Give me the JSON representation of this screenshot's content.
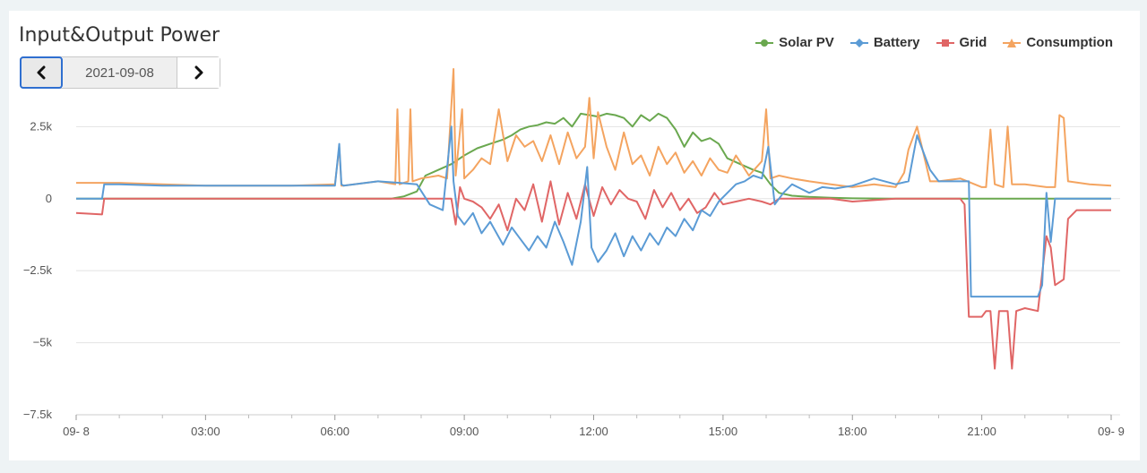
{
  "title": "Input&Output Power",
  "date_nav": {
    "date": "2021-09-08"
  },
  "colors": {
    "solar": "#6aa84f",
    "battery": "#5b9bd5",
    "grid": "#e06666",
    "consumption": "#f4a460"
  },
  "chart_data": {
    "type": "line",
    "title": "Input&Output Power",
    "xlabel": "",
    "ylabel": "",
    "ylim": [
      -7500,
      4500
    ],
    "xlim": [
      0,
      24
    ],
    "grid": "horizontal",
    "legend": "top-right",
    "yticks": [
      2500,
      0,
      -2500,
      -5000,
      -7500
    ],
    "ytick_labels": [
      "2.5k",
      "0",
      "−2.5k",
      "−5k",
      "−7.5k"
    ],
    "xticks": [
      0,
      3,
      6,
      9,
      12,
      15,
      18,
      21,
      24
    ],
    "xtick_labels": [
      "09- 8",
      "03:00",
      "06:00",
      "09:00",
      "12:00",
      "15:00",
      "18:00",
      "21:00",
      "09- 9"
    ],
    "series": [
      {
        "name": "Solar PV",
        "key": "solar",
        "marker": "circle",
        "x": [
          0,
          6,
          7.3,
          7.6,
          7.9,
          8.1,
          8.4,
          8.7,
          9.0,
          9.3,
          9.6,
          9.9,
          10.1,
          10.3,
          10.5,
          10.7,
          10.9,
          11.1,
          11.3,
          11.5,
          11.7,
          11.9,
          12.1,
          12.3,
          12.5,
          12.7,
          12.9,
          13.1,
          13.3,
          13.5,
          13.7,
          13.9,
          14.1,
          14.3,
          14.5,
          14.7,
          14.9,
          15.1,
          15.4,
          15.7,
          15.9,
          16.1,
          16.3,
          16.6,
          17.0,
          17.5,
          18.0,
          19.0,
          20.0,
          21.0,
          22.0,
          23.0,
          24.0
        ],
        "y": [
          0,
          0,
          0,
          80,
          250,
          800,
          1000,
          1200,
          1500,
          1750,
          1900,
          2050,
          2200,
          2400,
          2500,
          2550,
          2650,
          2600,
          2800,
          2500,
          2950,
          2900,
          2850,
          2950,
          2900,
          2800,
          2500,
          2900,
          2700,
          2950,
          2800,
          2400,
          1800,
          2300,
          2000,
          2100,
          1900,
          1400,
          1200,
          1000,
          900,
          500,
          200,
          100,
          60,
          30,
          10,
          0,
          0,
          0,
          0,
          0,
          0
        ]
      },
      {
        "name": "Battery",
        "key": "battery",
        "marker": "diamond",
        "x": [
          0,
          0.6,
          0.65,
          1,
          2,
          3,
          4,
          5,
          6,
          6.1,
          6.15,
          6.2,
          7,
          7.5,
          7.9,
          8.2,
          8.5,
          8.7,
          8.75,
          8.85,
          9.0,
          9.2,
          9.4,
          9.6,
          9.9,
          10.1,
          10.3,
          10.5,
          10.7,
          10.9,
          11.1,
          11.3,
          11.5,
          11.7,
          11.85,
          11.95,
          12.1,
          12.3,
          12.5,
          12.7,
          12.9,
          13.1,
          13.3,
          13.5,
          13.7,
          13.9,
          14.1,
          14.3,
          14.5,
          14.7,
          14.9,
          15.1,
          15.3,
          15.5,
          15.7,
          15.9,
          16.05,
          16.2,
          16.4,
          16.6,
          16.8,
          17.0,
          17.3,
          17.6,
          18.0,
          18.5,
          19.0,
          19.3,
          19.5,
          19.8,
          20.0,
          20.3,
          20.6,
          20.7,
          20.75,
          21.0,
          21.5,
          22.0,
          22.3,
          22.4,
          22.5,
          22.6,
          22.7,
          23.0,
          24.0
        ],
        "y": [
          0,
          0,
          500,
          500,
          450,
          450,
          450,
          450,
          450,
          1900,
          500,
          450,
          600,
          550,
          500,
          -200,
          -400,
          2500,
          600,
          -600,
          -900,
          -500,
          -1200,
          -800,
          -1600,
          -1000,
          -1400,
          -1800,
          -1300,
          -1700,
          -800,
          -1500,
          -2300,
          -800,
          1100,
          -1700,
          -2200,
          -1800,
          -1200,
          -2000,
          -1300,
          -1800,
          -1200,
          -1600,
          -1000,
          -1300,
          -700,
          -1100,
          -400,
          -600,
          -100,
          200,
          500,
          600,
          800,
          700,
          1800,
          -200,
          200,
          500,
          350,
          200,
          400,
          350,
          450,
          700,
          500,
          600,
          2200,
          1000,
          600,
          600,
          600,
          600,
          -3400,
          -3400,
          -3400,
          -3400,
          -3400,
          -3000,
          200,
          -1500,
          0,
          0,
          0
        ]
      },
      {
        "name": "Grid",
        "key": "grid",
        "marker": "square",
        "x": [
          0,
          0.6,
          0.65,
          1,
          6,
          7,
          8,
          8.7,
          8.8,
          8.9,
          9.0,
          9.2,
          9.4,
          9.6,
          9.8,
          10.0,
          10.2,
          10.4,
          10.6,
          10.8,
          11.0,
          11.2,
          11.4,
          11.6,
          11.8,
          12.0,
          12.2,
          12.4,
          12.6,
          12.8,
          13.0,
          13.2,
          13.4,
          13.6,
          13.8,
          14.0,
          14.2,
          14.4,
          14.6,
          14.8,
          15.0,
          15.3,
          15.6,
          15.9,
          16.1,
          16.3,
          16.6,
          17.0,
          17.5,
          18.0,
          19.0,
          20.0,
          20.5,
          20.6,
          20.7,
          21.0,
          21.1,
          21.2,
          21.3,
          21.4,
          21.5,
          21.6,
          21.7,
          21.8,
          22.0,
          22.3,
          22.5,
          22.6,
          22.7,
          22.9,
          23.0,
          23.2,
          23.5,
          24.0
        ],
        "y": [
          -500,
          -550,
          0,
          0,
          0,
          0,
          0,
          0,
          -900,
          400,
          0,
          -100,
          -300,
          -700,
          -200,
          -1100,
          0,
          -400,
          500,
          -800,
          600,
          -900,
          200,
          -700,
          500,
          -600,
          400,
          -200,
          300,
          0,
          -100,
          -700,
          300,
          -300,
          200,
          -400,
          0,
          -500,
          -300,
          200,
          -200,
          -100,
          0,
          -100,
          -200,
          0,
          0,
          0,
          0,
          -100,
          0,
          0,
          0,
          -200,
          -4100,
          -4100,
          -3900,
          -3900,
          -5900,
          -3900,
          -3900,
          -3900,
          -5900,
          -3900,
          -3800,
          -3900,
          -1300,
          -1700,
          -3000,
          -2800,
          -700,
          -400,
          -400,
          -400
        ]
      },
      {
        "name": "Consumption",
        "key": "consumption",
        "marker": "triangle",
        "x": [
          0,
          0.5,
          1,
          2,
          3,
          4,
          5,
          6,
          6.1,
          6.15,
          6.2,
          7,
          7.4,
          7.45,
          7.5,
          7.7,
          7.75,
          7.8,
          8.0,
          8.4,
          8.6,
          8.75,
          8.8,
          8.95,
          9.0,
          9.2,
          9.4,
          9.6,
          9.8,
          10.0,
          10.2,
          10.4,
          10.6,
          10.8,
          11.0,
          11.2,
          11.4,
          11.6,
          11.8,
          11.9,
          12.0,
          12.1,
          12.3,
          12.5,
          12.7,
          12.9,
          13.1,
          13.3,
          13.5,
          13.7,
          13.9,
          14.1,
          14.3,
          14.5,
          14.7,
          14.9,
          15.1,
          15.3,
          15.6,
          15.9,
          16.0,
          16.1,
          16.3,
          16.6,
          17.0,
          17.5,
          18.0,
          18.5,
          19.0,
          19.2,
          19.3,
          19.5,
          19.8,
          20.0,
          20.5,
          21.0,
          21.1,
          21.2,
          21.3,
          21.5,
          21.6,
          21.7,
          22.0,
          22.5,
          22.7,
          22.8,
          22.9,
          23.0,
          23.5,
          24.0
        ],
        "y": [
          550,
          550,
          550,
          500,
          450,
          450,
          450,
          500,
          1800,
          450,
          450,
          600,
          500,
          3100,
          500,
          600,
          3100,
          600,
          700,
          800,
          700,
          4500,
          800,
          3100,
          700,
          1000,
          1400,
          1200,
          3100,
          1300,
          2200,
          1800,
          2000,
          1300,
          2200,
          1200,
          2300,
          1400,
          1800,
          3500,
          1400,
          3000,
          1800,
          1000,
          2300,
          1200,
          1500,
          800,
          1800,
          1200,
          1600,
          900,
          1300,
          800,
          1400,
          1000,
          900,
          1500,
          800,
          1300,
          3100,
          700,
          800,
          700,
          600,
          500,
          400,
          500,
          400,
          900,
          1700,
          2500,
          600,
          600,
          700,
          400,
          400,
          2400,
          500,
          400,
          2500,
          500,
          500,
          400,
          400,
          2900,
          2800,
          600,
          500,
          450
        ]
      }
    ]
  }
}
